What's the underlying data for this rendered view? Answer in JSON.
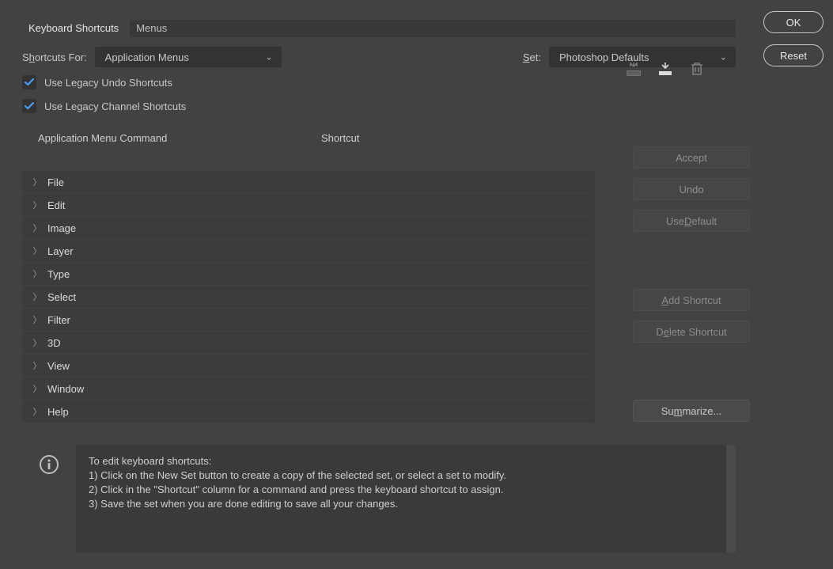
{
  "tabs": {
    "keyboard": "Keyboard Shortcuts",
    "menus": "Menus"
  },
  "labels": {
    "shortcutsFor_pre": "S",
    "shortcutsFor_u": "h",
    "shortcutsFor_post": "ortcuts For:",
    "set_u": "S",
    "set_post": "et:",
    "legacyUndo": "Use Legacy Undo Shortcuts",
    "legacyChannel": "Use Legacy Channel Shortcuts"
  },
  "selects": {
    "shortcutsFor": "Application Menus",
    "set": "Photoshop Defaults"
  },
  "columns": {
    "command": "Application Menu Command",
    "shortcut": "Shortcut"
  },
  "menuItems": [
    "File",
    "Edit",
    "Image",
    "Layer",
    "Type",
    "Select",
    "Filter",
    "3D",
    "View",
    "Window",
    "Help"
  ],
  "buttons": {
    "accept": "Accept",
    "undo": "Undo",
    "useDefault_pre": "Use ",
    "useDefault_u": "D",
    "useDefault_post": "efault",
    "addShortcut_u": "A",
    "addShortcut_post": "dd Shortcut",
    "deleteShortcut_pre": "D",
    "deleteShortcut_u": "e",
    "deleteShortcut_post": "lete Shortcut",
    "summarize_pre": "Su",
    "summarize_u": "m",
    "summarize_post": "marize...",
    "ok": "OK",
    "reset": "Reset"
  },
  "info": {
    "l1": "To edit keyboard shortcuts:",
    "l2": "1) Click on the New Set button to create a copy of the selected set, or select a set to modify.",
    "l3": "2) Click in the \"Shortcut\" column for a command and press the keyboard shortcut to assign.",
    "l4": "3) Save the set when you are done editing to save all your changes."
  }
}
